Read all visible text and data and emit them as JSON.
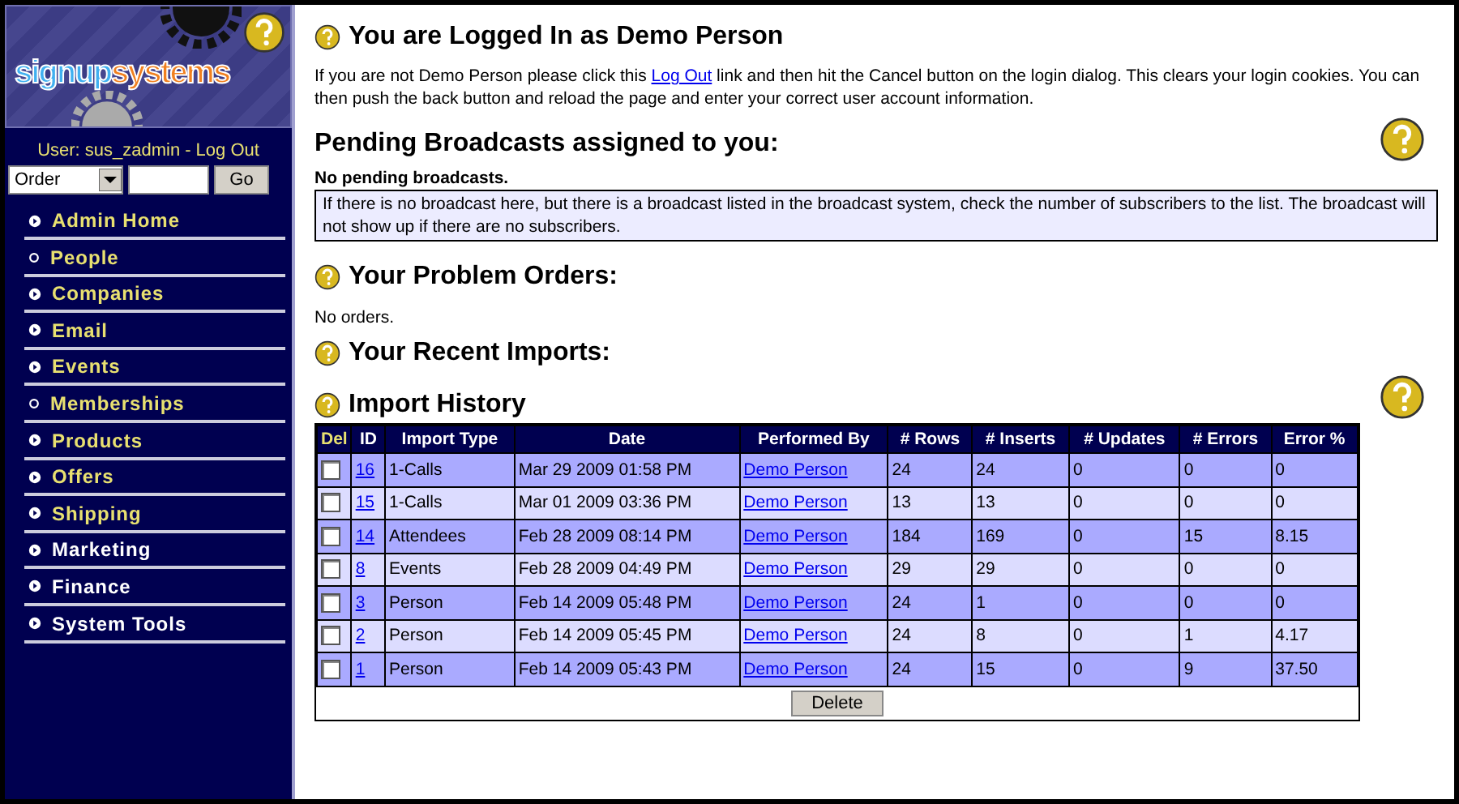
{
  "logo": {
    "part1": "signup",
    "part2": "systems"
  },
  "user_bar": {
    "label": "User: sus_zadmin",
    "separator": "-",
    "logout": "Log Out"
  },
  "search": {
    "type": "Order",
    "button": "Go"
  },
  "nav": [
    {
      "label": "Admin Home",
      "kind": "arrow",
      "color": "#e8e070"
    },
    {
      "label": "People",
      "kind": "circle",
      "color": "#e8e070"
    },
    {
      "label": "Companies",
      "kind": "arrow",
      "color": "#e8e070"
    },
    {
      "label": "Email",
      "kind": "arrow",
      "color": "#e8e070"
    },
    {
      "label": "Events",
      "kind": "arrow",
      "color": "#e8e070"
    },
    {
      "label": "Memberships",
      "kind": "circle",
      "color": "#e8e070"
    },
    {
      "label": "Products",
      "kind": "arrow",
      "color": "#e8e070"
    },
    {
      "label": "Offers",
      "kind": "arrow",
      "color": "#e8e070"
    },
    {
      "label": "Shipping",
      "kind": "arrow",
      "color": "#e8e070"
    },
    {
      "label": "Marketing",
      "kind": "arrow",
      "color": "#ffffff"
    },
    {
      "label": "Finance",
      "kind": "arrow",
      "color": "#ffffff"
    },
    {
      "label": "System Tools",
      "kind": "arrow",
      "color": "#ffffff"
    }
  ],
  "logged_in": {
    "title": "You are Logged In as Demo Person",
    "text_before": "If you are not Demo Person please click this",
    "link": "Log Out",
    "text_after": "link and then hit the Cancel button on the login dialog. This clears your login cookies. You can then push the back button and reload the page and enter your correct user account information."
  },
  "pending": {
    "title": "Pending Broadcasts assigned to you:",
    "status": "No pending broadcasts.",
    "note": "If there is no broadcast here, but there is a broadcast listed in the broadcast system, check the number of subscribers to the list. The broadcast will not show up if there are no subscribers."
  },
  "problem_orders": {
    "title": "Your Problem Orders:",
    "status": "No orders."
  },
  "recent_imports": {
    "title": "Your Recent Imports:"
  },
  "import_history": {
    "title": "Import History",
    "button": "Delete",
    "table": {
      "columns": [
        "Del",
        "ID",
        "Import Type",
        "Date",
        "Performed By",
        "# Rows",
        "# Inserts",
        "# Updates",
        "# Errors",
        "Error %"
      ],
      "rows": [
        {
          "checked": false,
          "id": "16",
          "type": "1-Calls",
          "date": "Mar 29 2009 01:58 PM",
          "by": "Demo Person",
          "rows": "24",
          "inserts": "24",
          "updates": "0",
          "errors": "0",
          "error_pct": "0"
        },
        {
          "checked": false,
          "id": "15",
          "type": "1-Calls",
          "date": "Mar 01 2009 03:36 PM",
          "by": "Demo Person",
          "rows": "13",
          "inserts": "13",
          "updates": "0",
          "errors": "0",
          "error_pct": "0"
        },
        {
          "checked": false,
          "id": "14",
          "type": "Attendees",
          "date": "Feb 28 2009 08:14 PM",
          "by": "Demo Person",
          "rows": "184",
          "inserts": "169",
          "updates": "0",
          "errors": "15",
          "error_pct": "8.15"
        },
        {
          "checked": false,
          "id": "8",
          "type": "Events",
          "date": "Feb 28 2009 04:49 PM",
          "by": "Demo Person",
          "rows": "29",
          "inserts": "29",
          "updates": "0",
          "errors": "0",
          "error_pct": "0"
        },
        {
          "checked": false,
          "id": "3",
          "type": "Person",
          "date": "Feb 14 2009 05:48 PM",
          "by": "Demo Person",
          "rows": "24",
          "inserts": "1",
          "updates": "0",
          "errors": "0",
          "error_pct": "0"
        },
        {
          "checked": false,
          "id": "2",
          "type": "Person",
          "date": "Feb 14 2009 05:45 PM",
          "by": "Demo Person",
          "rows": "24",
          "inserts": "8",
          "updates": "0",
          "errors": "1",
          "error_pct": "4.17"
        },
        {
          "checked": false,
          "id": "1",
          "type": "Person",
          "date": "Feb 14 2009 05:43 PM",
          "by": "Demo Person",
          "rows": "24",
          "inserts": "15",
          "updates": "0",
          "errors": "9",
          "error_pct": "37.50"
        }
      ]
    }
  }
}
